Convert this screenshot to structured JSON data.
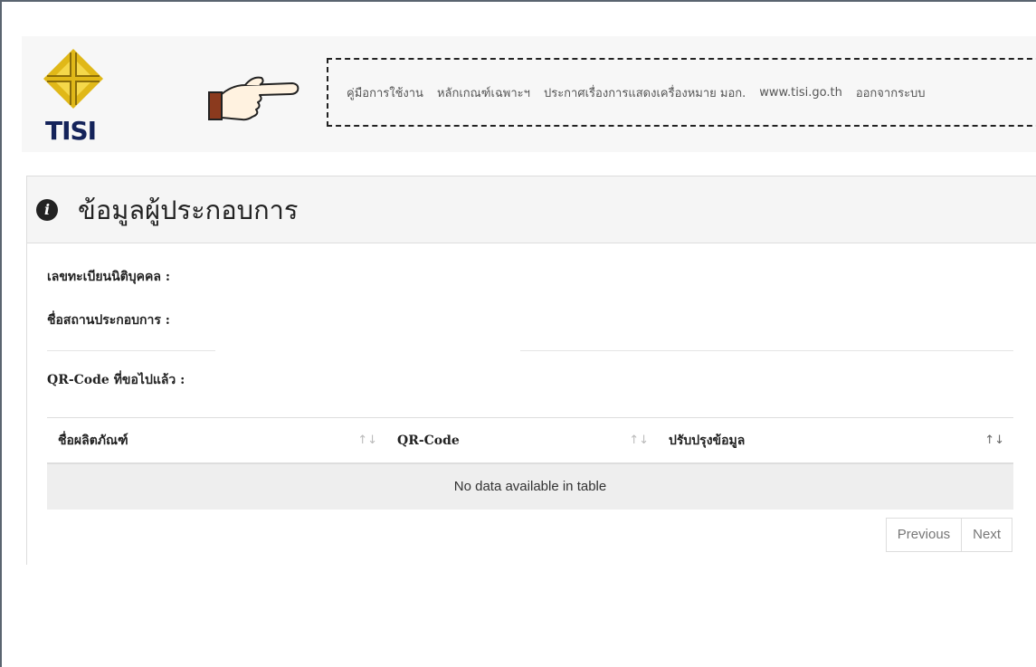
{
  "logo": {
    "text": "TISI"
  },
  "nav": {
    "items": [
      "คู่มือการใช้งาน",
      "หลักเกณฑ์เฉพาะฯ",
      "ประกาศเรื่องการแสดงเครื่องหมาย มอก.",
      "www.tisi.go.th",
      "ออกจากระบบ"
    ]
  },
  "panel": {
    "title": "ข้อมูลผู้ประกอบการ",
    "fields": {
      "registration_label": "เลขทะเบียนนิติบุคคล :",
      "establishment_label": "ชื่อสถานประกอบการ :",
      "qrcode_label": "QR-Code ที่ขอไปแล้ว :"
    }
  },
  "table": {
    "columns": [
      "ชื่อผลิตภัณฑ์",
      "QR-Code",
      "ปรับปรุงข้อมูล"
    ],
    "sort_icons": [
      "↑↓",
      "↑↓",
      "↑↓"
    ],
    "empty_message": "No data available in table"
  },
  "pagination": {
    "previous": "Previous",
    "next": "Next"
  },
  "colors": {
    "logo_gold": "#e0b818",
    "logo_navy": "#14235a",
    "pointer_cuff": "#8b3a1e"
  }
}
